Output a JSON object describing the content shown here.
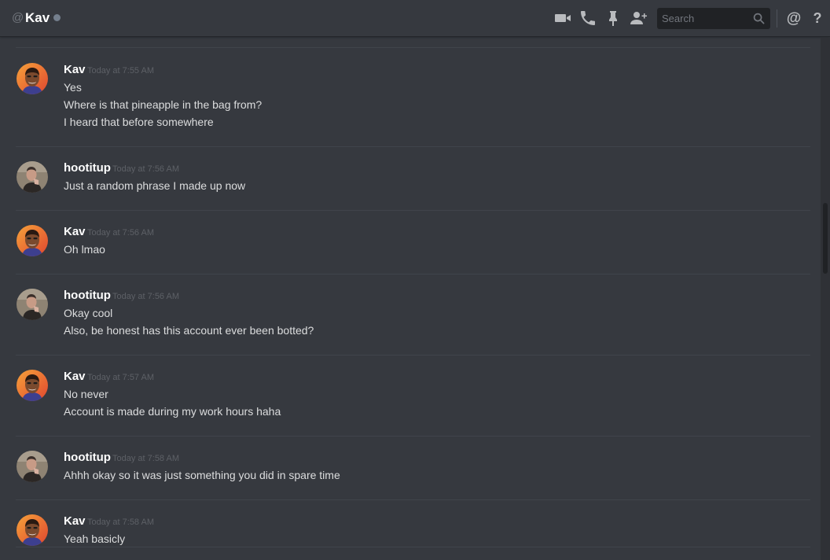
{
  "header": {
    "at_symbol": "@",
    "channel_name": "Kav",
    "status_color": "#747f8d",
    "icons": [
      "video-call-icon",
      "voice-call-icon",
      "pin-icon",
      "add-friend-icon",
      "mention-icon",
      "help-icon"
    ],
    "mention_glyph": "@",
    "help_glyph": "?",
    "search": {
      "placeholder": "Search",
      "value": ""
    }
  },
  "colors": {
    "background": "#36393f",
    "username": "#ffffff",
    "message_text": "#dcddde",
    "timestamp": "#5d6066",
    "divider": "#40444b"
  },
  "messages": [
    {
      "author": "Kav",
      "avatar": "kav-avatar",
      "timestamp": "Today at 7:55 AM",
      "lines": [
        "Yes",
        "Where is that pineapple in the bag from?",
        "I heard that before somewhere"
      ]
    },
    {
      "author": "hootitup",
      "avatar": "hootitup-avatar",
      "timestamp": "Today at 7:56 AM",
      "lines": [
        "Just a random phrase I made up now"
      ]
    },
    {
      "author": "Kav",
      "avatar": "kav-avatar",
      "timestamp": "Today at 7:56 AM",
      "lines": [
        "Oh lmao"
      ]
    },
    {
      "author": "hootitup",
      "avatar": "hootitup-avatar",
      "timestamp": "Today at 7:56 AM",
      "lines": [
        "Okay cool",
        "Also, be honest has this account ever been botted?"
      ]
    },
    {
      "author": "Kav",
      "avatar": "kav-avatar",
      "timestamp": "Today at 7:57 AM",
      "lines": [
        "No never",
        "Account is made during my work hours haha"
      ]
    },
    {
      "author": "hootitup",
      "avatar": "hootitup-avatar",
      "timestamp": "Today at 7:58 AM",
      "lines": [
        "Ahhh okay so it was just something you did in spare time"
      ]
    },
    {
      "author": "Kav",
      "avatar": "kav-avatar",
      "timestamp": "Today at 7:58 AM",
      "lines": [
        "Yeah basicly"
      ]
    }
  ]
}
